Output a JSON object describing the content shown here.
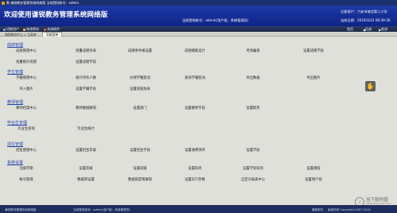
{
  "window": {
    "title": "数 谦锐教务管理系统网络版     当前登陆帐号：admin"
  },
  "header": {
    "app_title": "欢迎使用谦锐教务管理系统网络版",
    "account": "当前登陆帐号：admin(用户组：系统管理员)",
    "unit": "注册用户：六安市城北第二小学",
    "datetime": "当前日期：2010/3/22  08:39:30"
  },
  "toolbar": {
    "items": [
      "切换用户",
      "修改密码",
      "关闭软件"
    ],
    "right_items": [
      "首页",
      "后退",
      "前进"
    ]
  },
  "tabbar": {
    "breadcrumb": "谦锐教务中心 > 主菜单",
    "active_tab": "导航菜单"
  },
  "sections": [
    {
      "title": "成绩管理",
      "rows": [
        [
          "成绩管理中心",
          "批量成绩导表",
          "成绩条件报设置",
          "成绩模板设计",
          "考场编排",
          "设置成绩学段"
        ],
        [
          "批量统计成绩",
          "设置成绩字段"
        ]
      ]
    },
    {
      "title": "学生管理",
      "rows": [
        [
          "学籍管理中心",
          "统计所有人数",
          "办理学籍变动",
          "查询学籍变动",
          "导出数据",
          "导出图片"
        ],
        [
          "导入图片",
          "设置学籍字段",
          "设置班级加表"
        ]
      ]
    },
    {
      "title": "教师管理",
      "rows": [
        [
          "教师档案中心",
          "教师数据解锁",
          "设置部门",
          "设置教师字段",
          "设置职务"
        ]
      ]
    },
    {
      "title": "毕业生管理",
      "rows": [
        [
          "毕业生查询",
          "毕业生统计"
        ]
      ]
    },
    {
      "title": "招生管理",
      "rows": [
        [
          "招生管理中心",
          "设置招生年级",
          "设置招生字段",
          "设置收费项目",
          "设置学段"
        ]
      ]
    },
    {
      "title": "系统设置",
      "rows": [
        [
          "注册学期",
          "设置年级",
          "设置班级",
          "设置科目",
          "设置学校科目",
          "设置课程"
        ],
        [
          "帐号管理",
          "数据库设置",
          "数据锁定和解锁",
          "设置实行参数",
          "自定义报表中心",
          "设置用户组"
        ]
      ]
    }
  ],
  "floating_button": {
    "label": "✋"
  },
  "statusbar": {
    "app": "谦锐教务管理系统网络版",
    "user": "当前登陆帐号：admin(用户组：系统管理员)",
    "company": "谦锐软件",
    "copyright": "版权所有 Copyright 2007-2010"
  },
  "watermark": {
    "glyph": "↓",
    "name": "当下软件园",
    "url": "www.downxia.com"
  }
}
